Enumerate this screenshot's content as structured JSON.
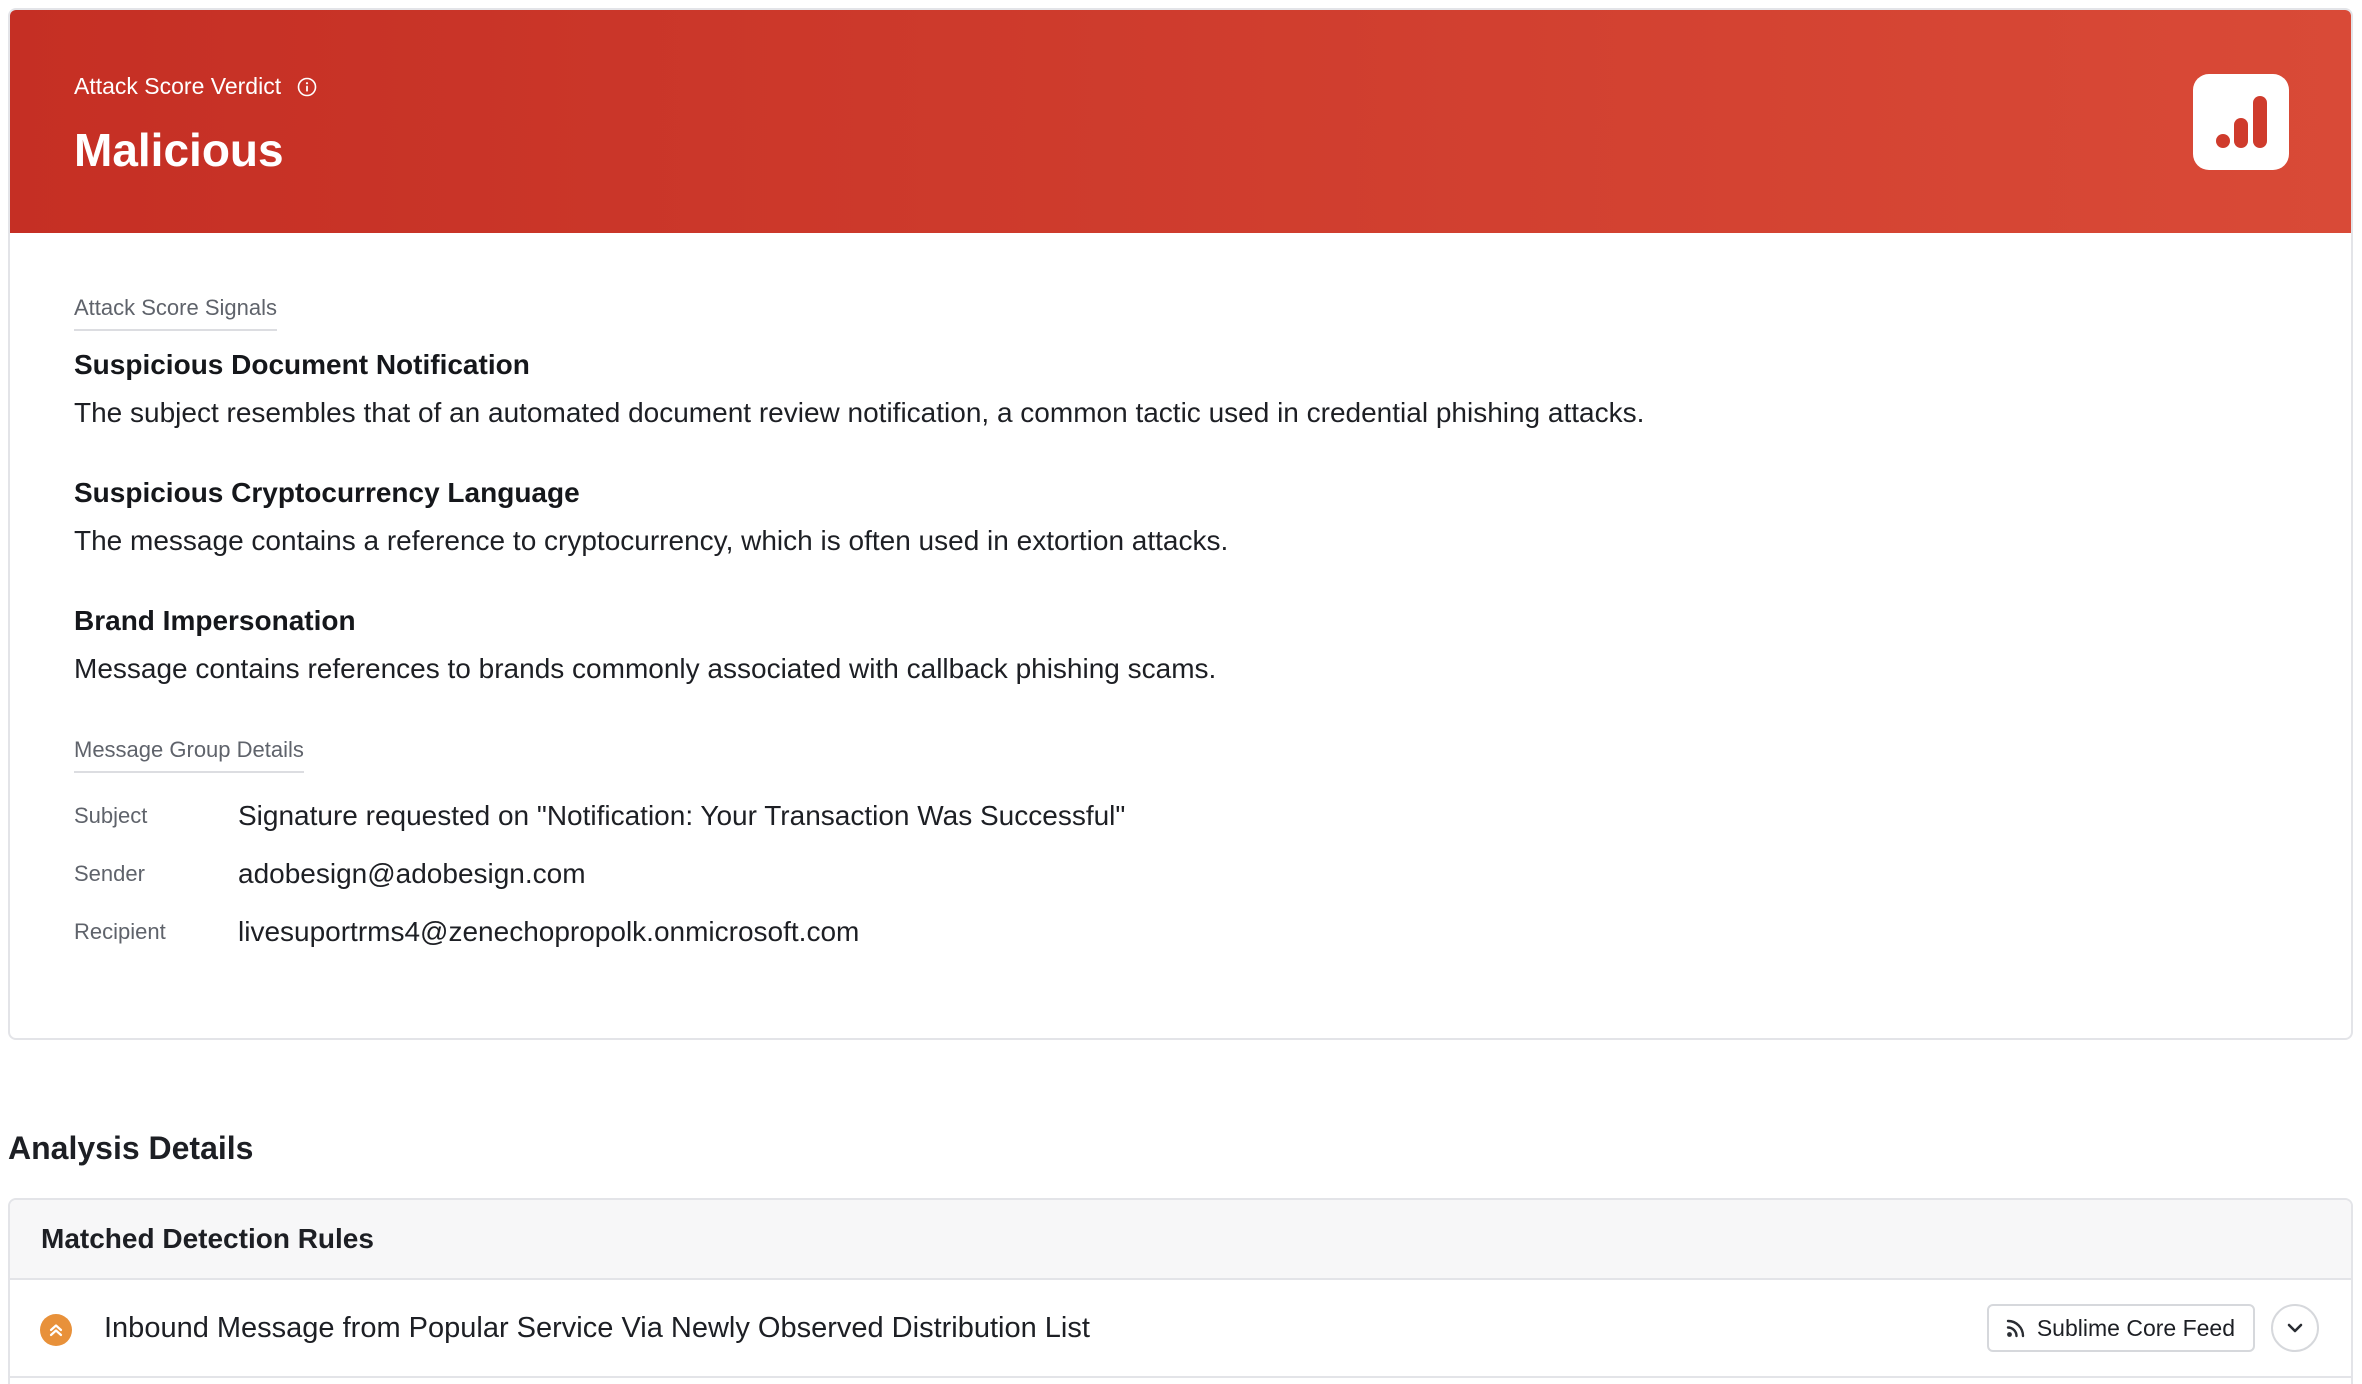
{
  "verdict": {
    "label": "Attack Score Verdict",
    "value": "Malicious",
    "header_color": "#c52f24",
    "info_icon": "info-icon",
    "badge_icon": "bar-chart-icon"
  },
  "signals": {
    "section_label": "Attack Score Signals",
    "items": [
      {
        "title": "Suspicious Document Notification",
        "description": "The subject resembles that of an automated document review notification, a common tactic used in credential phishing attacks."
      },
      {
        "title": "Suspicious Cryptocurrency Language",
        "description": "The message contains a reference to cryptocurrency, which is often used in extortion attacks."
      },
      {
        "title": "Brand Impersonation",
        "description": "Message contains references to brands commonly associated with callback phishing scams."
      }
    ]
  },
  "message_group": {
    "section_label": "Message Group Details",
    "rows": [
      {
        "key": "Subject",
        "value": "Signature requested on \"Notification: Your Transaction Was Successful\""
      },
      {
        "key": "Sender",
        "value": "adobesign@adobesign.com"
      },
      {
        "key": "Recipient",
        "value": "livesuportrms4@zenechopropolk.onmicrosoft.com"
      }
    ]
  },
  "analysis": {
    "title": "Analysis Details",
    "rules_header": "Matched Detection Rules",
    "rules": [
      {
        "name": "Inbound Message from Popular Service Via Newly Observed Distribution List",
        "severity_color": "#e8913a",
        "severity_icon": "chevrons-up-icon",
        "feed_label": "Sublime Core Feed",
        "feed_icon": "rss-icon",
        "expand_icon": "chevron-down-icon"
      }
    ]
  }
}
